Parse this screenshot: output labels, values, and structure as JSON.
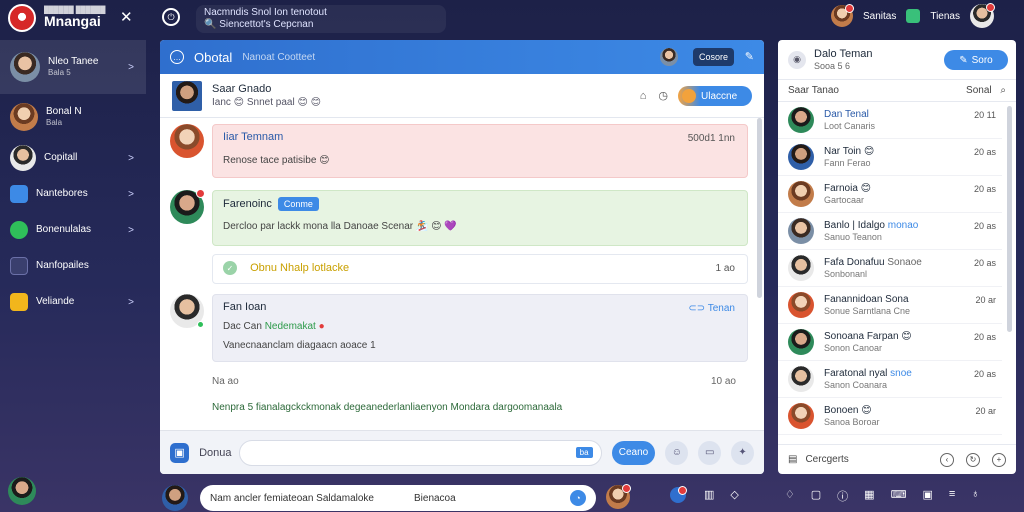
{
  "app": {
    "brand_small": "██████ ██████",
    "brand_name": "Mnangai",
    "top_search_line1": "Nacmndis Snol Ion tenotout",
    "top_search_line2": "Siencettot's Cepcnan",
    "top_right_label1": "Sanitas",
    "top_right_label2": "Tienas"
  },
  "sidebar": {
    "items": [
      {
        "label": "Nleo Tanee",
        "sub": "Bala 5"
      },
      {
        "label": "Bonal N",
        "sub": "Bala"
      },
      {
        "label": "Copitall"
      },
      {
        "label": "Nantebores"
      },
      {
        "label": "Bonenulalas"
      },
      {
        "label": "Nanfopailes"
      },
      {
        "label": "Veliande"
      }
    ]
  },
  "chat": {
    "title": "Obotal",
    "subtitle": "Nanoat Cootteet",
    "head_pill": "Cosore",
    "contact_name": "Saar Gnado",
    "contact_sub": "Ianc 😊 Snnet paal 😊 😊",
    "contact_btn": "Ulaccne",
    "messages": [
      {
        "title": "Iiar Temnam",
        "time": "500d1 1nn",
        "body": "Renose tace patisibe 😊"
      },
      {
        "title": "Farenoinc",
        "tag": "Conme",
        "body": "Dercloo par lackk mona lla Danoae Scenar 🏂 😊 💜"
      },
      {
        "title": "Obnu Nhalp lotlacke",
        "time": "1  ao"
      },
      {
        "title": "Fan Ioan",
        "right_label": "Tenan",
        "line2_a": "Dac Can",
        "line2_b": "Nedemakat",
        "body": "Vanecnaanclam diagaacn aoace 1"
      }
    ],
    "footer_left": "Na  ao",
    "footer_right": "10  ao",
    "footer_text": "Nenpra 5 fianalagckckmonak degeanederlanliaenyon Mondara dargoomanaala",
    "composer_placeholder": "Donua",
    "composer_badge": "ba",
    "send_label": "Ceano"
  },
  "right_panel": {
    "title": "Dalo Teman",
    "sub": "Sooa 5 6",
    "btn": "Soro",
    "list_header": "Saar Tanao",
    "list_header_right": "Sonal",
    "items": [
      {
        "name": "Dan Tenal",
        "sub": "Loot Canaris",
        "time": "20  11"
      },
      {
        "name": "Nar Toin 😊",
        "sub": "Fann Ferao",
        "time": "20  as"
      },
      {
        "name": "Farnoia 😊",
        "sub": "Gartocaar",
        "time": "20  as"
      },
      {
        "name": "Banlo | Idalgo",
        "tag": "monao",
        "sub": "Sanuo Teanon",
        "time": "20  as"
      },
      {
        "name": "Fafa Donafuu",
        "tag": "Sonaoe",
        "sub": "Sonbonanl",
        "time": "20  as"
      },
      {
        "name": "Fanannidoan Sona",
        "sub": "Sonue Sarntlana Cne",
        "time": "20  ar"
      },
      {
        "name": "Sonoana Farpan 😊",
        "sub": "Sonon Canoar",
        "time": "20  as"
      },
      {
        "name": "Faratonal nyal",
        "tag": "snoe",
        "sub": "Sanon Coanara",
        "time": "20  as"
      },
      {
        "name": "Bonoen 😊",
        "sub": "Sanoa Boroar",
        "time": "20  ar"
      }
    ],
    "footer_label": "Cercgerts"
  },
  "dock": {
    "search_text": "Nam ancler femiateoan Saldamaloke",
    "search_label": "Bienacoa"
  },
  "colors": {
    "accent": "#3d8ae6",
    "header_blue": "#2f6fce",
    "dark_bg": "#1d2148",
    "danger": "#e23b3b",
    "online": "#2fbf5a"
  }
}
